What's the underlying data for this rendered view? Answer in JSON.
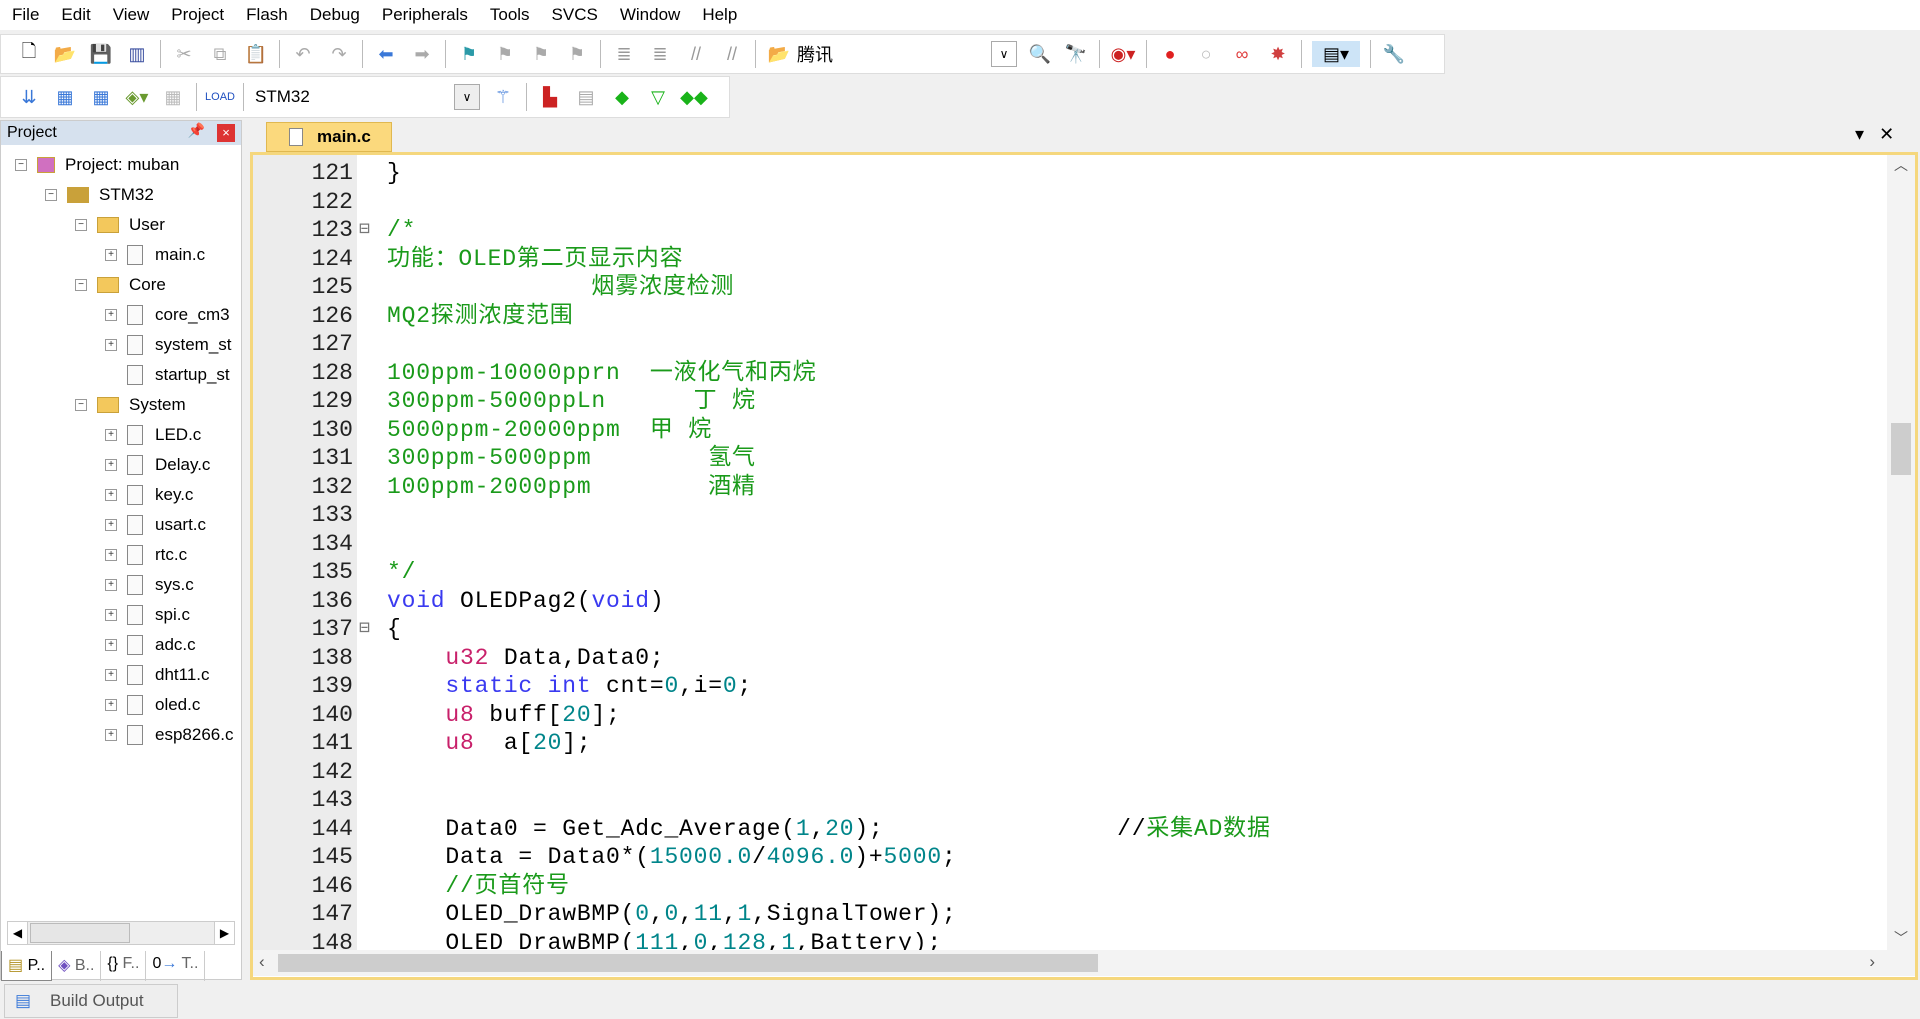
{
  "menu": [
    "File",
    "Edit",
    "View",
    "Project",
    "Flash",
    "Debug",
    "Peripherals",
    "Tools",
    "SVCS",
    "Window",
    "Help"
  ],
  "toolbar": {
    "find_text": "腾讯",
    "target": "STM32"
  },
  "project_pane": {
    "title": "Project",
    "tree": [
      {
        "label": "Project: muban",
        "level": 0,
        "kind": "project"
      },
      {
        "label": "STM32",
        "level": 1,
        "kind": "target"
      },
      {
        "label": "User",
        "level": 2,
        "kind": "folder"
      },
      {
        "label": "main.c",
        "level": 3,
        "kind": "file"
      },
      {
        "label": "Core",
        "level": 2,
        "kind": "folder"
      },
      {
        "label": "core_cm3",
        "level": 3,
        "kind": "file"
      },
      {
        "label": "system_st",
        "level": 3,
        "kind": "file"
      },
      {
        "label": "startup_st",
        "level": 3,
        "kind": "file",
        "noexp": true
      },
      {
        "label": "System",
        "level": 2,
        "kind": "folder"
      },
      {
        "label": "LED.c",
        "level": 3,
        "kind": "file"
      },
      {
        "label": "Delay.c",
        "level": 3,
        "kind": "file"
      },
      {
        "label": "key.c",
        "level": 3,
        "kind": "file"
      },
      {
        "label": "usart.c",
        "level": 3,
        "kind": "file"
      },
      {
        "label": "rtc.c",
        "level": 3,
        "kind": "file"
      },
      {
        "label": "sys.c",
        "level": 3,
        "kind": "file"
      },
      {
        "label": "spi.c",
        "level": 3,
        "kind": "file"
      },
      {
        "label": "adc.c",
        "level": 3,
        "kind": "file"
      },
      {
        "label": "dht11.c",
        "level": 3,
        "kind": "file"
      },
      {
        "label": "oled.c",
        "level": 3,
        "kind": "file"
      },
      {
        "label": "esp8266.c",
        "level": 3,
        "kind": "file"
      }
    ],
    "tabs": [
      "P..",
      "B..",
      "F..",
      "T.."
    ]
  },
  "editor": {
    "tab": "main.c",
    "lines": [
      {
        "n": "121",
        "t": [
          [
            "p",
            "}"
          ]
        ]
      },
      {
        "n": "122",
        "t": []
      },
      {
        "n": "123",
        "t": [
          [
            "cm",
            "/*"
          ]
        ],
        "fold": true
      },
      {
        "n": "124",
        "t": [
          [
            "cm",
            "功能：OLED第二页显示内容"
          ]
        ]
      },
      {
        "n": "125",
        "t": [
          [
            "cm",
            "              烟雾浓度检测"
          ]
        ]
      },
      {
        "n": "126",
        "t": [
          [
            "cm",
            "MQ2探测浓度范围"
          ]
        ]
      },
      {
        "n": "127",
        "t": []
      },
      {
        "n": "128",
        "t": [
          [
            "cm",
            "100ppm-10000pprn  一液化气和丙烷"
          ]
        ]
      },
      {
        "n": "129",
        "t": [
          [
            "cm",
            "300ppm-5000ppLn      丁 烷"
          ]
        ]
      },
      {
        "n": "130",
        "t": [
          [
            "cm",
            "5000ppm-20000ppm  甲 烷"
          ]
        ]
      },
      {
        "n": "131",
        "t": [
          [
            "cm",
            "300ppm-5000ppm        氢气"
          ]
        ]
      },
      {
        "n": "132",
        "t": [
          [
            "cm",
            "100ppm-2000ppm        酒精"
          ]
        ]
      },
      {
        "n": "133",
        "t": []
      },
      {
        "n": "134",
        "t": []
      },
      {
        "n": "135",
        "t": [
          [
            "cm",
            "*/"
          ]
        ]
      },
      {
        "n": "136",
        "t": [
          [
            "kw",
            "void"
          ],
          [
            "p",
            " OLEDPag2("
          ],
          [
            "kw",
            "void"
          ],
          [
            "p",
            ")"
          ]
        ]
      },
      {
        "n": "137",
        "t": [
          [
            "p",
            "{"
          ]
        ],
        "fold": true
      },
      {
        "n": "138",
        "t": [
          [
            "p",
            "    "
          ],
          [
            "ty",
            "u32"
          ],
          [
            "p",
            " Data,Data0;"
          ]
        ]
      },
      {
        "n": "139",
        "t": [
          [
            "p",
            "    "
          ],
          [
            "kw",
            "static int"
          ],
          [
            "p",
            " cnt="
          ],
          [
            "nm",
            "0"
          ],
          [
            "p",
            ",i="
          ],
          [
            "nm",
            "0"
          ],
          [
            "p",
            ";"
          ]
        ]
      },
      {
        "n": "140",
        "t": [
          [
            "p",
            "    "
          ],
          [
            "ty",
            "u8"
          ],
          [
            "p",
            " buff["
          ],
          [
            "nm",
            "20"
          ],
          [
            "p",
            "];"
          ]
        ]
      },
      {
        "n": "141",
        "t": [
          [
            "p",
            "    "
          ],
          [
            "ty",
            "u8"
          ],
          [
            "p",
            "  a["
          ],
          [
            "nm",
            "20"
          ],
          [
            "p",
            "];"
          ]
        ]
      },
      {
        "n": "142",
        "t": []
      },
      {
        "n": "143",
        "t": []
      },
      {
        "n": "144",
        "t": [
          [
            "p",
            "    Data0 = Get_Adc_Average("
          ],
          [
            "nm",
            "1"
          ],
          [
            "p",
            ","
          ],
          [
            "nm",
            "20"
          ],
          [
            "p",
            ");                //"
          ],
          [
            "cm",
            "采集AD数据"
          ]
        ]
      },
      {
        "n": "145",
        "t": [
          [
            "p",
            "    Data = Data0*("
          ],
          [
            "nm",
            "15000.0"
          ],
          [
            "p",
            "/"
          ],
          [
            "nm",
            "4096.0"
          ],
          [
            "p",
            ")+"
          ],
          [
            "nm",
            "5000"
          ],
          [
            "p",
            ";"
          ]
        ]
      },
      {
        "n": "146",
        "t": [
          [
            "p",
            "    "
          ],
          [
            "cm",
            "//页首符号"
          ]
        ]
      },
      {
        "n": "147",
        "t": [
          [
            "p",
            "    OLED_DrawBMP("
          ],
          [
            "nm",
            "0"
          ],
          [
            "p",
            ","
          ],
          [
            "nm",
            "0"
          ],
          [
            "p",
            ","
          ],
          [
            "nm",
            "11"
          ],
          [
            "p",
            ","
          ],
          [
            "nm",
            "1"
          ],
          [
            "p",
            ",SignalTower);"
          ]
        ]
      },
      {
        "n": "148",
        "t": [
          [
            "p",
            "    OLED_DrawBMP("
          ],
          [
            "nm",
            "111"
          ],
          [
            "p",
            ","
          ],
          [
            "nm",
            "0"
          ],
          [
            "p",
            ","
          ],
          [
            "nm",
            "128"
          ],
          [
            "p",
            ","
          ],
          [
            "nm",
            "1"
          ],
          [
            "p",
            ",Battery);"
          ]
        ]
      }
    ]
  },
  "bottom": {
    "build_output": "Build Output"
  },
  "colors": {
    "keyword": "#3a3af0",
    "type": "#c8206a",
    "number": "#00858a",
    "comment": "#1a9a1a",
    "tab_active": "#fbd97d"
  }
}
